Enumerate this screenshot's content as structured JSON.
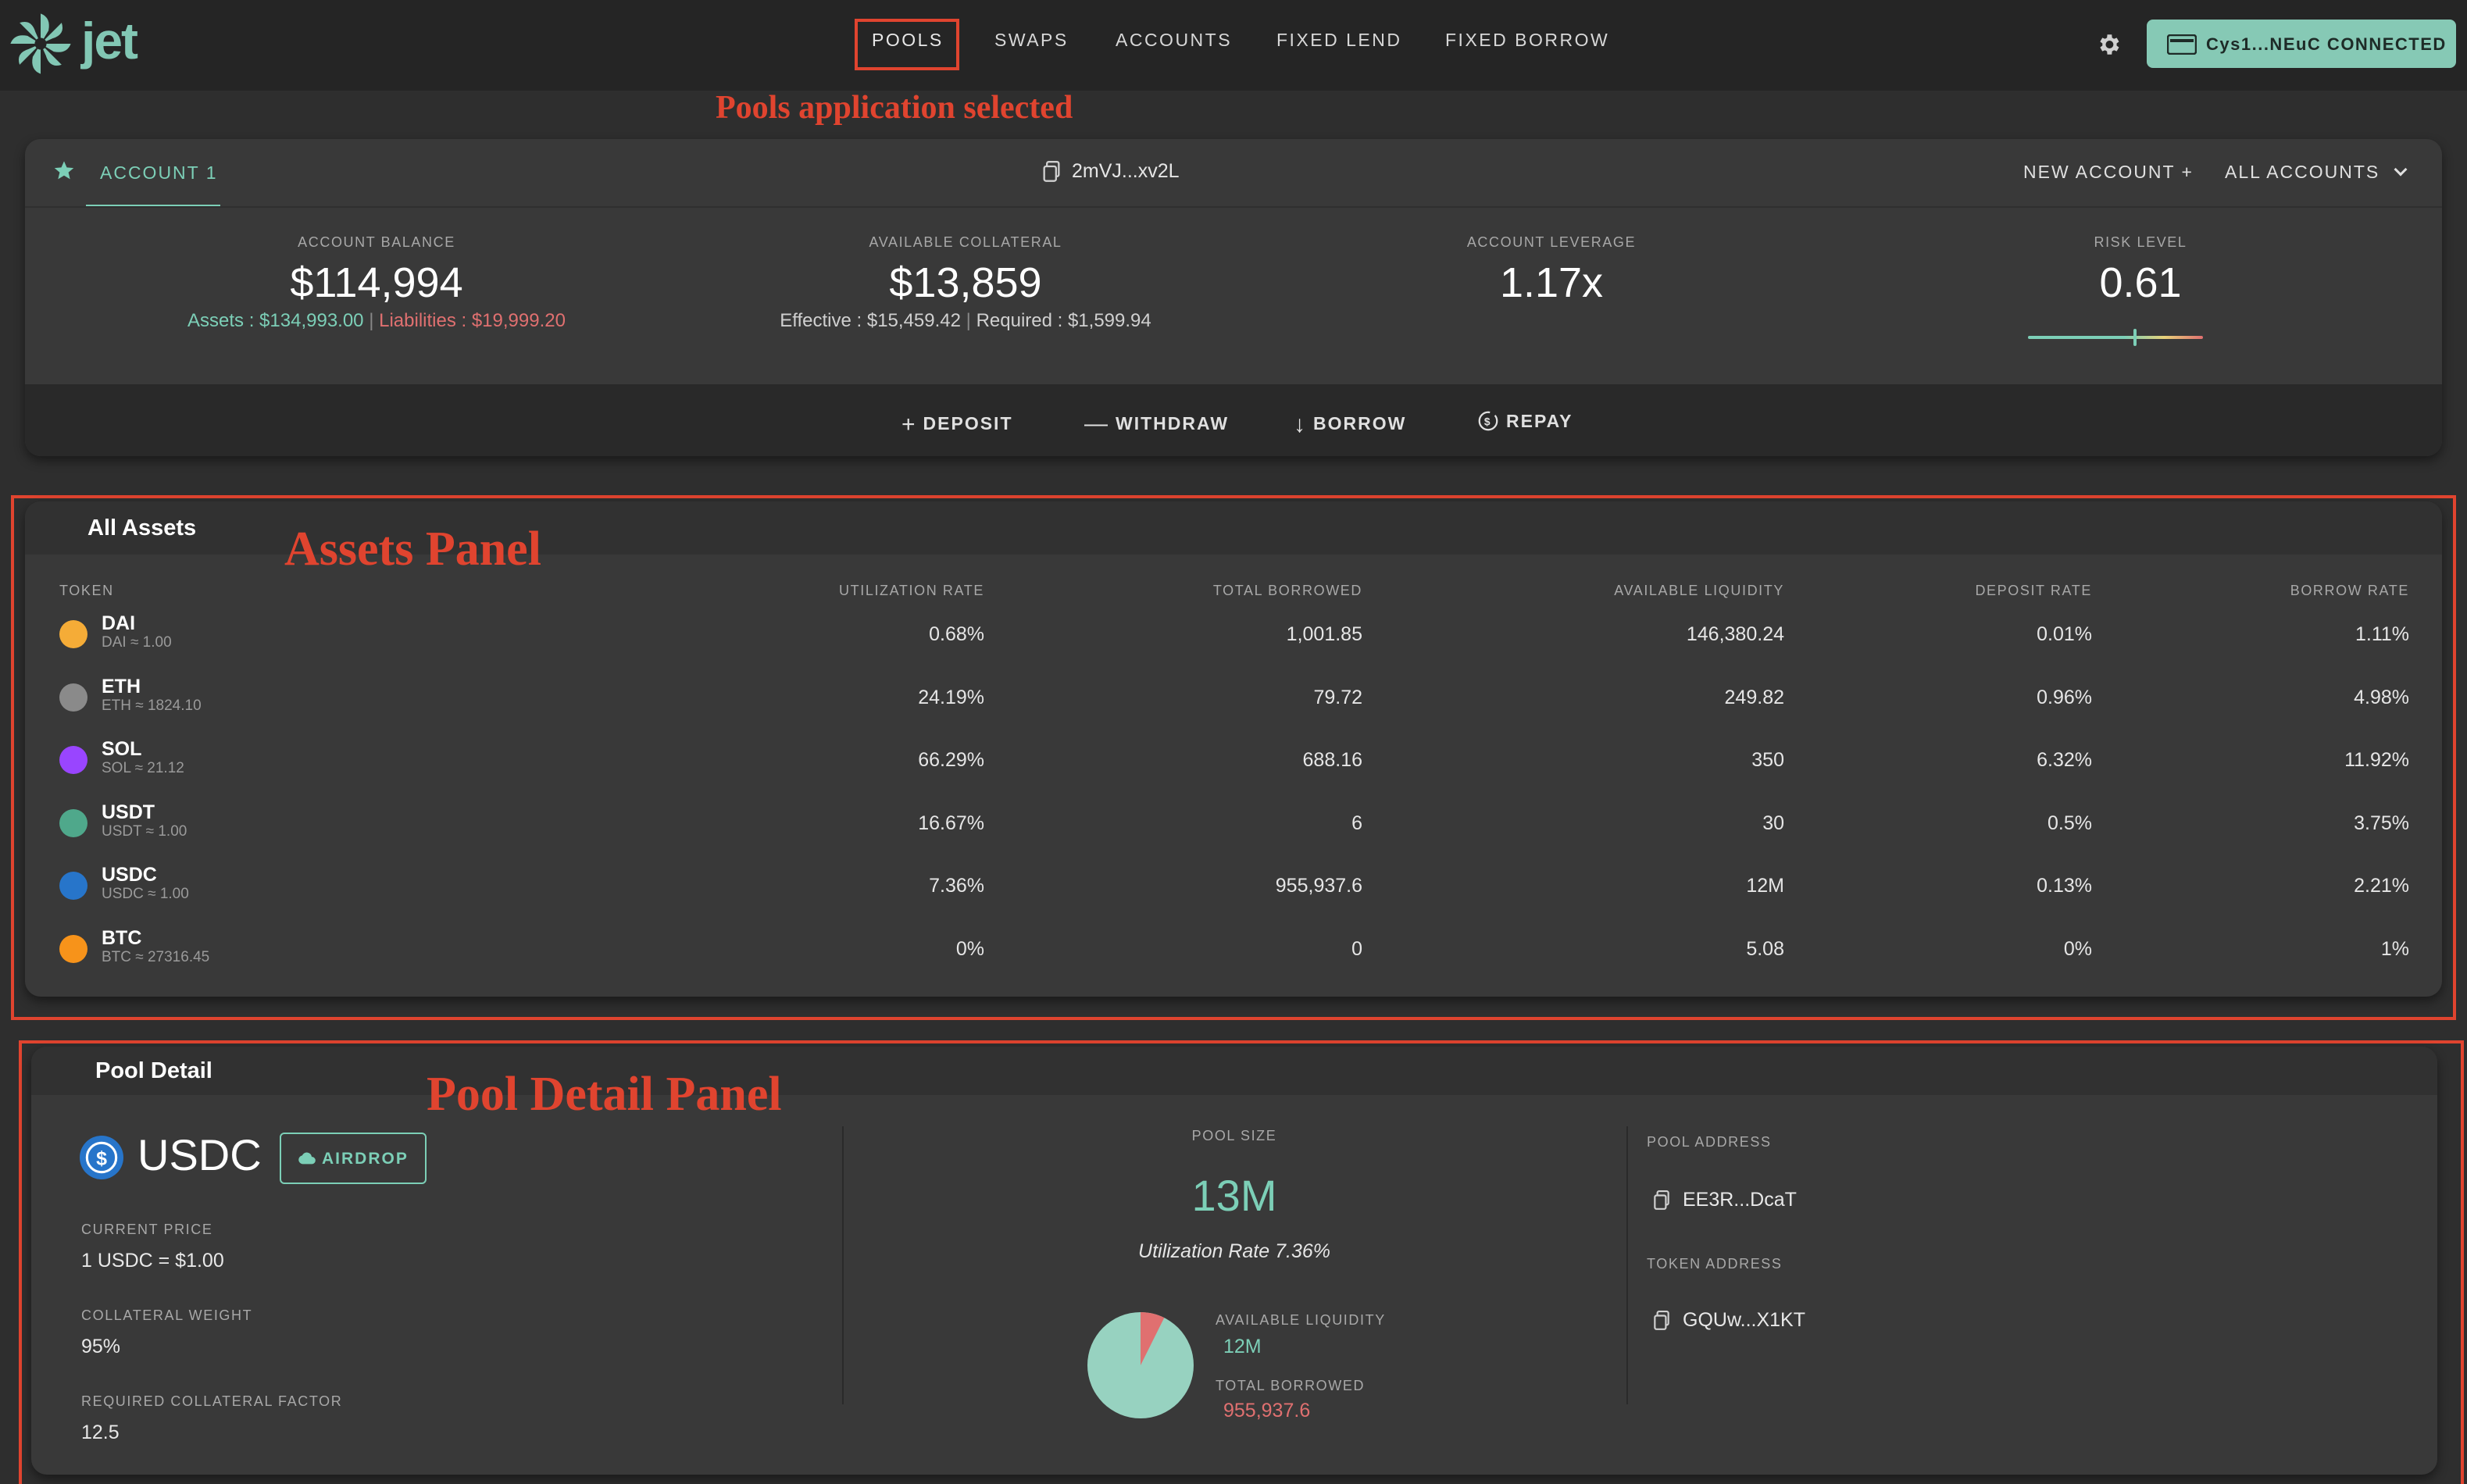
{
  "header": {
    "logo_text": "jet",
    "nav": [
      "POOLS",
      "SWAPS",
      "ACCOUNTS",
      "FIXED LEND",
      "FIXED BORROW"
    ],
    "active_nav": "POOLS",
    "wallet_label": "Cys1...NEuC CONNECTED",
    "icons": {
      "settings": "gear-icon",
      "wallet": "wallet-icon"
    }
  },
  "annotations": {
    "pools_selected": "Pools application selected",
    "assets_panel": "Assets Panel",
    "pool_detail_panel": "Pool Detail Panel"
  },
  "account": {
    "tab_label": "ACCOUNT 1",
    "address": "2mVJ...xv2L",
    "new_account": "NEW ACCOUNT +",
    "all_accounts": "ALL ACCOUNTS",
    "balance_label": "ACCOUNT BALANCE",
    "balance": "$114,994",
    "assets_text": "Assets : $134,993.00",
    "liabilities_text": "Liabilities : $19,999.20",
    "collateral_label": "AVAILABLE COLLATERAL",
    "collateral": "$13,859",
    "effective_text": "Effective : $15,459.42",
    "required_text": "Required : $1,599.94",
    "leverage_label": "ACCOUNT LEVERAGE",
    "leverage": "1.17x",
    "risk_label": "RISK LEVEL",
    "risk": "0.61",
    "risk_fraction": 0.61,
    "actions": {
      "deposit": "DEPOSIT",
      "withdraw": "WITHDRAW",
      "borrow": "BORROW",
      "repay": "REPAY"
    }
  },
  "assets": {
    "title": "All Assets",
    "columns": [
      "TOKEN",
      "UTILIZATION RATE",
      "TOTAL BORROWED",
      "AVAILABLE LIQUIDITY",
      "DEPOSIT RATE",
      "BORROW RATE"
    ],
    "rows": [
      {
        "symbol": "DAI",
        "price": "DAI ≈ 1.00",
        "util": "0.68%",
        "borrowed": "1,001.85",
        "liquidity": "146,380.24",
        "deposit": "0.01%",
        "borrow": "1.11%",
        "icon": "dai-icon",
        "color": "#f5ac37"
      },
      {
        "symbol": "ETH",
        "price": "ETH ≈ 1824.10",
        "util": "24.19%",
        "borrowed": "79.72",
        "liquidity": "249.82",
        "deposit": "0.96%",
        "borrow": "4.98%",
        "icon": "eth-icon",
        "color": "#8a8a8a"
      },
      {
        "symbol": "SOL",
        "price": "SOL ≈ 21.12",
        "util": "66.29%",
        "borrowed": "688.16",
        "liquidity": "350",
        "deposit": "6.32%",
        "borrow": "11.92%",
        "icon": "sol-icon",
        "color": "#9945ff"
      },
      {
        "symbol": "USDT",
        "price": "USDT ≈ 1.00",
        "util": "16.67%",
        "borrowed": "6",
        "liquidity": "30",
        "deposit": "0.5%",
        "borrow": "3.75%",
        "icon": "usdt-icon",
        "color": "#4fa88b"
      },
      {
        "symbol": "USDC",
        "price": "USDC ≈ 1.00",
        "util": "7.36%",
        "borrowed": "955,937.6",
        "liquidity": "12M",
        "deposit": "0.13%",
        "borrow": "2.21%",
        "icon": "usdc-icon",
        "color": "#2775ca"
      },
      {
        "symbol": "BTC",
        "price": "BTC ≈ 27316.45",
        "util": "0%",
        "borrowed": "0",
        "liquidity": "5.08",
        "deposit": "0%",
        "borrow": "1%",
        "icon": "btc-icon",
        "color": "#f7931a"
      }
    ]
  },
  "pool_detail": {
    "title": "Pool Detail",
    "token": "USDC",
    "airdrop_label": "AIRDROP",
    "current_price_label": "CURRENT PRICE",
    "current_price": "1 USDC = $1.00",
    "collateral_weight_label": "COLLATERAL WEIGHT",
    "collateral_weight": "95%",
    "req_factor_label": "REQUIRED COLLATERAL FACTOR",
    "req_factor": "12.5",
    "pool_size_label": "POOL SIZE",
    "pool_size": "13M",
    "utilization_text": "Utilization Rate 7.36%",
    "utilization_fraction": 0.0736,
    "avail_liq_label": "AVAILABLE LIQUIDITY",
    "avail_liq": "12M",
    "total_borrowed_label": "TOTAL BORROWED",
    "total_borrowed": "955,937.6",
    "pool_address_label": "POOL ADDRESS",
    "pool_address": "EE3R...DcaT",
    "token_address_label": "TOKEN ADDRESS",
    "token_address": "GQUw...X1KT"
  },
  "colors": {
    "accent": "#7ccfb7",
    "negative": "#e07070",
    "annotation": "#e0442f"
  }
}
